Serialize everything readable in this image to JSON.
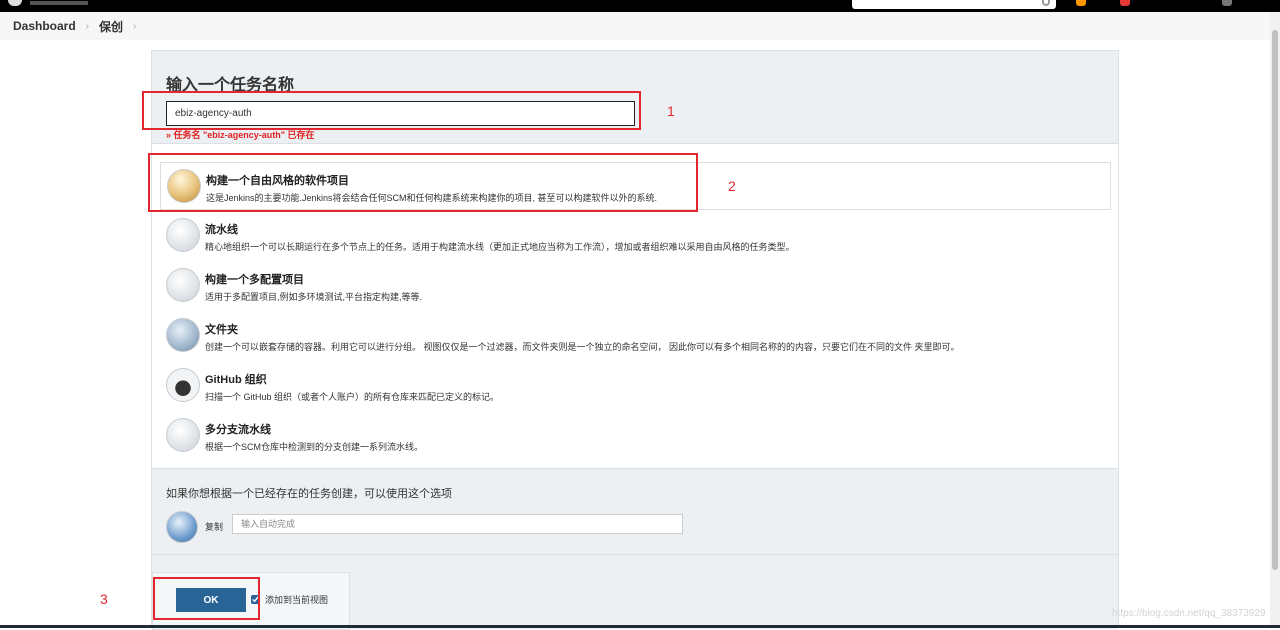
{
  "breadcrumb": {
    "items": [
      "Dashboard",
      "保创"
    ],
    "separator": "›"
  },
  "form": {
    "title": "输入一个任务名称",
    "name_value": "ebiz-agency-auth",
    "name_error": "» 任务名 \"ebiz-agency-auth\" 已存在"
  },
  "item_types": [
    {
      "name": "构建一个自由风格的软件项目",
      "description": "这是Jenkins的主要功能.Jenkins将会结合任何SCM和任何构建系统来构建你的项目, 甚至可以构建软件以外的系统.",
      "icon": "freestyle-package-icon"
    },
    {
      "name": "流水线",
      "description": "精心地组织一个可以长期运行在多个节点上的任务。适用于构建流水线（更加正式地应当称为工作流），增加或者组织难以采用自由风格的任务类型。",
      "icon": "pipeline-icon"
    },
    {
      "name": "构建一个多配置项目",
      "description": "适用于多配置项目,例如多环境测试,平台指定构建,等等.",
      "icon": "multi-config-icon"
    },
    {
      "name": "文件夹",
      "description": "创建一个可以嵌套存储的容器。利用它可以进行分组。 视图仅仅是一个过滤器，而文件夹则是一个独立的命名空间， 因此你可以有多个相同名称的的内容，只要它们在不同的文件 夹里即可。",
      "icon": "folder-icon"
    },
    {
      "name": "GitHub 组织",
      "description": "扫描一个 GitHub 组织（或者个人账户）的所有仓库来匹配已定义的标记。",
      "icon": "github-icon"
    },
    {
      "name": "多分支流水线",
      "description": "根据一个SCM仓库中检测到的分支创建一系列流水线。",
      "icon": "multibranch-icon"
    }
  ],
  "copy": {
    "hint": "如果你想根据一个已经存在的任务创建，可以使用这个选项",
    "label": "复制",
    "placeholder": "输入自动完成"
  },
  "actions": {
    "ok_label": "OK",
    "add_to_view_label": "添加到当前视图",
    "add_to_view_checked": true
  },
  "annotations": [
    "1",
    "2",
    "3"
  ],
  "watermark": "https://blog.csdn.net/qq_38373929",
  "colors": {
    "annotation": "#e0282e",
    "primary_button": "#2a6496",
    "error": "#e02020"
  }
}
